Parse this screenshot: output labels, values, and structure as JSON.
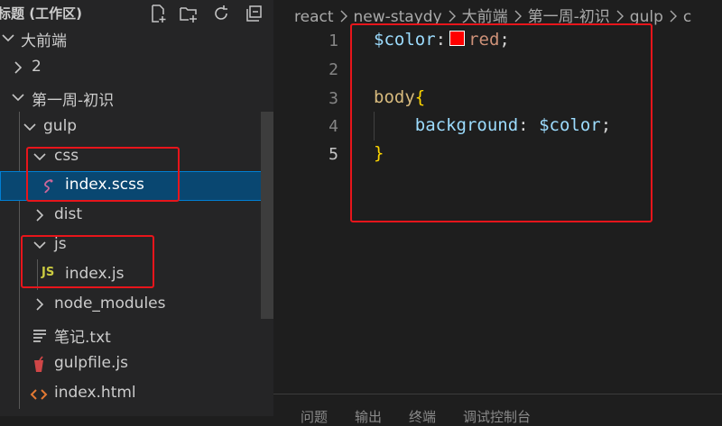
{
  "sidebar": {
    "title": "标题 (工作区)",
    "toolbar": [
      {
        "icon": "new-file-icon"
      },
      {
        "icon": "new-folder-icon"
      },
      {
        "icon": "refresh-icon"
      },
      {
        "icon": "collapse-all-icon"
      }
    ],
    "tree": [
      {
        "label": "大前端",
        "type": "folder",
        "expanded": true
      },
      {
        "label": "2",
        "type": "folder",
        "expanded": false
      },
      {
        "label": "第一周-初识",
        "type": "folder",
        "expanded": true
      },
      {
        "label": "gulp",
        "type": "folder",
        "expanded": true
      },
      {
        "label": "css",
        "type": "folder",
        "expanded": true
      },
      {
        "label": "index.scss",
        "type": "file",
        "icon": "sass-file-icon",
        "selected": true
      },
      {
        "label": "dist",
        "type": "folder",
        "expanded": false
      },
      {
        "label": "js",
        "type": "folder",
        "expanded": true
      },
      {
        "label": "index.js",
        "type": "file",
        "icon": "js-file-icon",
        "icon_text": "JS"
      },
      {
        "label": "node_modules",
        "type": "folder",
        "expanded": false
      },
      {
        "label": "笔记.txt",
        "type": "file",
        "icon": "text-file-icon"
      },
      {
        "label": "gulpfile.js",
        "type": "file",
        "icon": "gulp-file-icon"
      },
      {
        "label": "index.html",
        "type": "file",
        "icon": "html-file-icon"
      }
    ]
  },
  "editor": {
    "breadcrumb": [
      "react",
      "new-staydy",
      "大前端",
      "第一周-初识",
      "gulp",
      "c"
    ],
    "active_line": 5,
    "lines": [
      {
        "num": "1",
        "tokens": [
          "$color",
          ":",
          "red",
          ";"
        ]
      },
      {
        "num": "2",
        "tokens": []
      },
      {
        "num": "3",
        "tokens": [
          "body",
          "{"
        ]
      },
      {
        "num": "4",
        "tokens": [
          "background",
          ":",
          "$color",
          ";"
        ]
      },
      {
        "num": "5",
        "tokens": [
          "}"
        ]
      }
    ],
    "color_swatch": "#ff0000"
  },
  "panel": {
    "tabs": [
      "问题",
      "输出",
      "终端",
      "调试控制台"
    ]
  },
  "colors": {
    "annotation": "#e8151b",
    "selection": "#094771",
    "sidebar_bg": "#252526",
    "editor_bg": "#1e1e1e"
  }
}
